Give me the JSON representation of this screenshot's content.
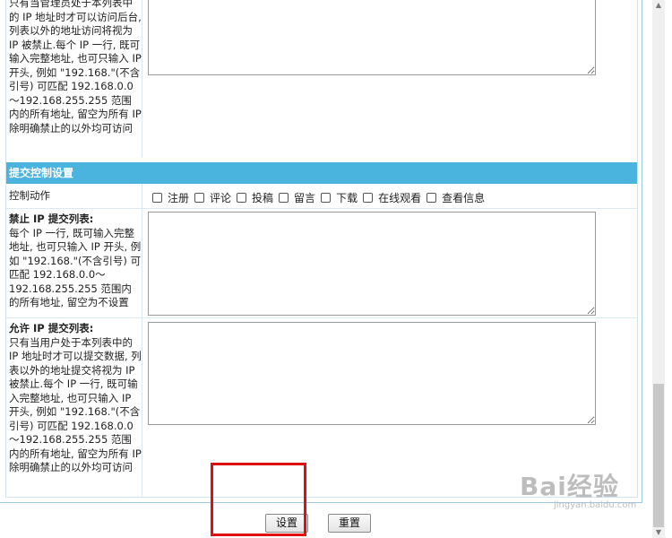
{
  "rows": {
    "admin_ip_tail": {
      "text": "只有当管理员处于本列表中的 IP 地址时才可以访问后台, 列表以外的地址访问将视为 IP 被禁止.每个 IP 一行, 既可输入完整地址, 也可只输入 IP 开头, 例如 \"192.168.\"(不含引号) 可匹配 192.168.0.0～192.168.255.255 范围内的所有地址, 留空为所有 IP 除明确禁止的以外均可访问"
    },
    "submit_section_title": "提交控制设置",
    "control_action": {
      "label": "控制动作",
      "options": [
        "注册",
        "评论",
        "投稿",
        "留言",
        "下载",
        "在线观看",
        "查看信息"
      ]
    },
    "ban_submit": {
      "title": "禁止 IP 提交列表:",
      "desc": "每个 IP 一行, 既可输入完整地址, 也可只输入 IP 开头, 例如 \"192.168.\"(不含引号) 可匹配 192.168.0.0～192.168.255.255 范围内的所有地址, 留空为不设置"
    },
    "allow_submit": {
      "title": "允许 IP 提交列表:",
      "desc": "只有当用户处于本列表中的 IP 地址时才可以提交数据, 列表以外的地址提交将视为 IP 被禁止.每个 IP 一行, 既可输入完整地址, 也可只输入 IP 开头, 例如 \"192.168.\"(不含引号) 可匹配 192.168.0.0～192.168.255.255 范围内的所有地址, 留空为所有 IP 除明确禁止的以外均可访问"
    }
  },
  "buttons": {
    "submit": "设置",
    "reset": "重置"
  },
  "watermark": {
    "main": "Bai经验",
    "sub": "jingyan.baidu.com"
  }
}
